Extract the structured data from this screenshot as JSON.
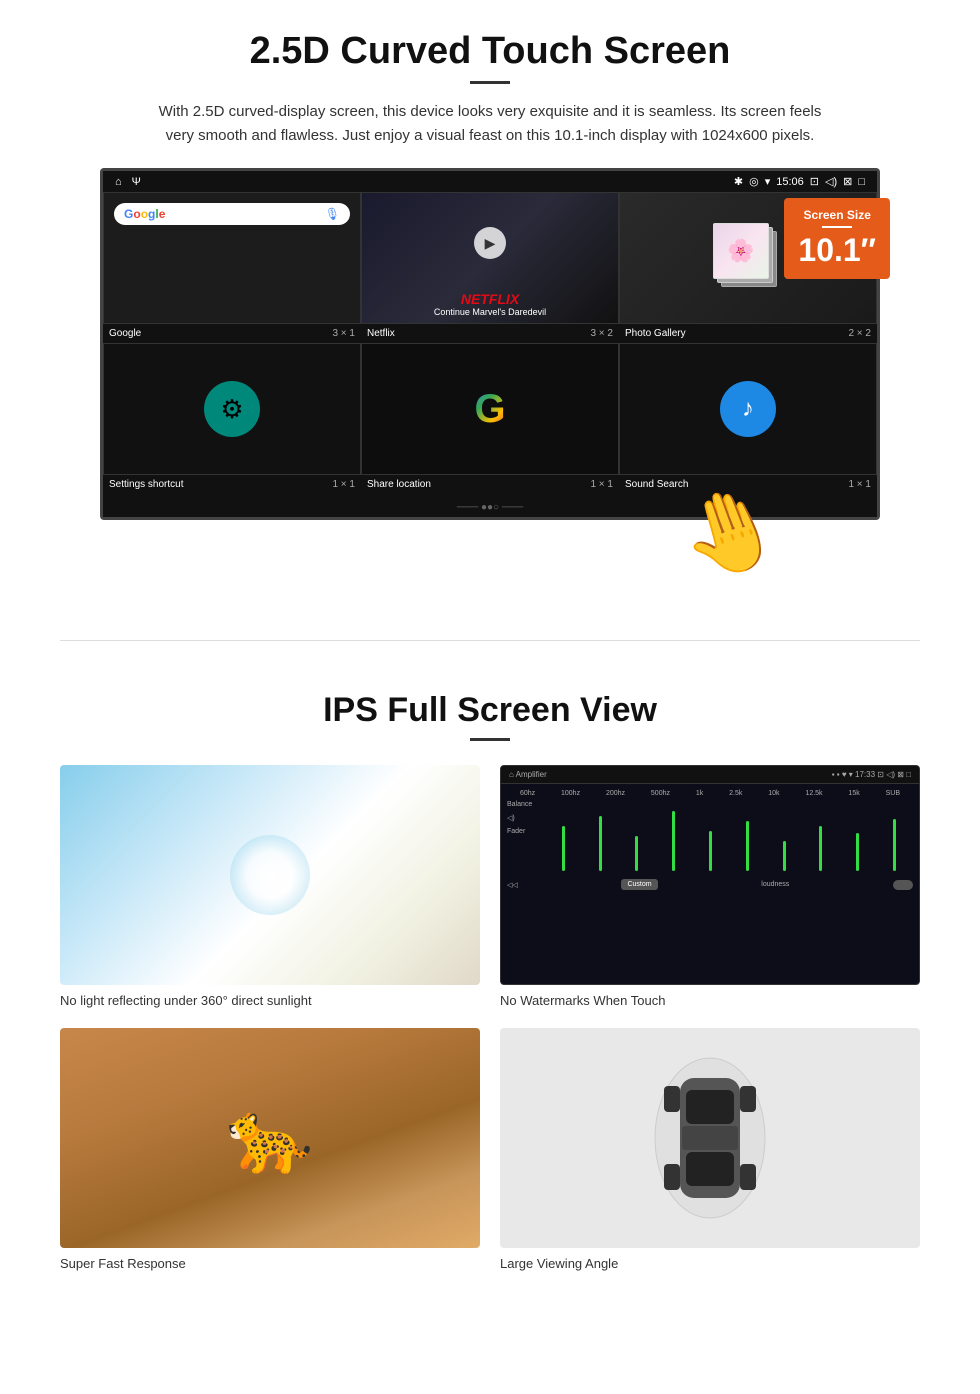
{
  "section1": {
    "title": "2.5D Curved Touch Screen",
    "description": "With 2.5D curved-display screen, this device looks very exquisite and it is seamless. Its screen feels very smooth and flawless. Just enjoy a visual feast on this 10.1-inch display with 1024x600 pixels.",
    "screen_size_badge_label": "Screen Size",
    "screen_size_value": "10.1″",
    "status_time": "15:06",
    "app_labels": {
      "google": "Google",
      "netflix": "Netflix",
      "photo_gallery": "Photo Gallery",
      "settings": "Settings shortcut",
      "share_location": "Share location",
      "sound_search": "Sound Search"
    },
    "grid_sizes": {
      "google": "3 × 1",
      "netflix": "3 × 2",
      "photo_gallery": "2 × 2",
      "settings": "1 × 1",
      "share_location": "1 × 1",
      "sound_search": "1 × 1"
    },
    "netflix_label": "NETFLIX",
    "netflix_sub": "Continue Marvel's Daredevil"
  },
  "section2": {
    "title": "IPS Full Screen View",
    "features": [
      {
        "caption": "No light reflecting under 360° direct sunlight"
      },
      {
        "caption": "No Watermarks When Touch"
      },
      {
        "caption": "Super Fast Response"
      },
      {
        "caption": "Large Viewing Angle"
      }
    ]
  }
}
